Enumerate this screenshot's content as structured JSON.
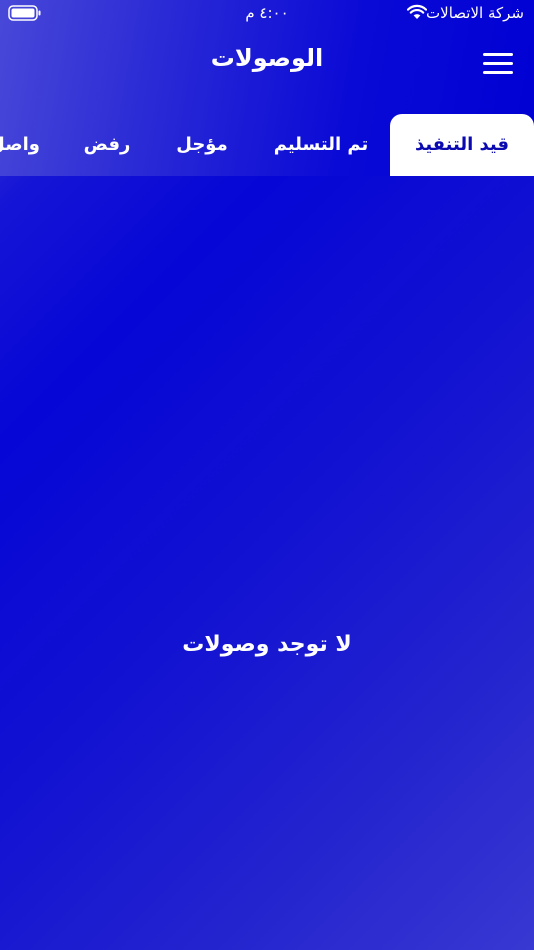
{
  "status_bar": {
    "carrier": "شركة الاتصالات",
    "time": "٤:٠٠ م",
    "wifi_icon": "wifi-icon",
    "battery_icon": "battery-icon"
  },
  "header": {
    "title": "الوصولات",
    "menu_icon": "hamburger-menu-icon"
  },
  "tabs": [
    {
      "label": "قيد التنفيذ",
      "active": true
    },
    {
      "label": "تم التسليم",
      "active": false
    },
    {
      "label": "مؤجل",
      "active": false
    },
    {
      "label": "رفض",
      "active": false
    },
    {
      "label": "واصل",
      "active": false
    }
  ],
  "main": {
    "empty_message": "لا توجد وصولات"
  },
  "colors": {
    "primary": "#0606d6",
    "tab_active_bg": "#ffffff",
    "tab_active_text": "#0a0ab0",
    "text": "#ffffff"
  }
}
